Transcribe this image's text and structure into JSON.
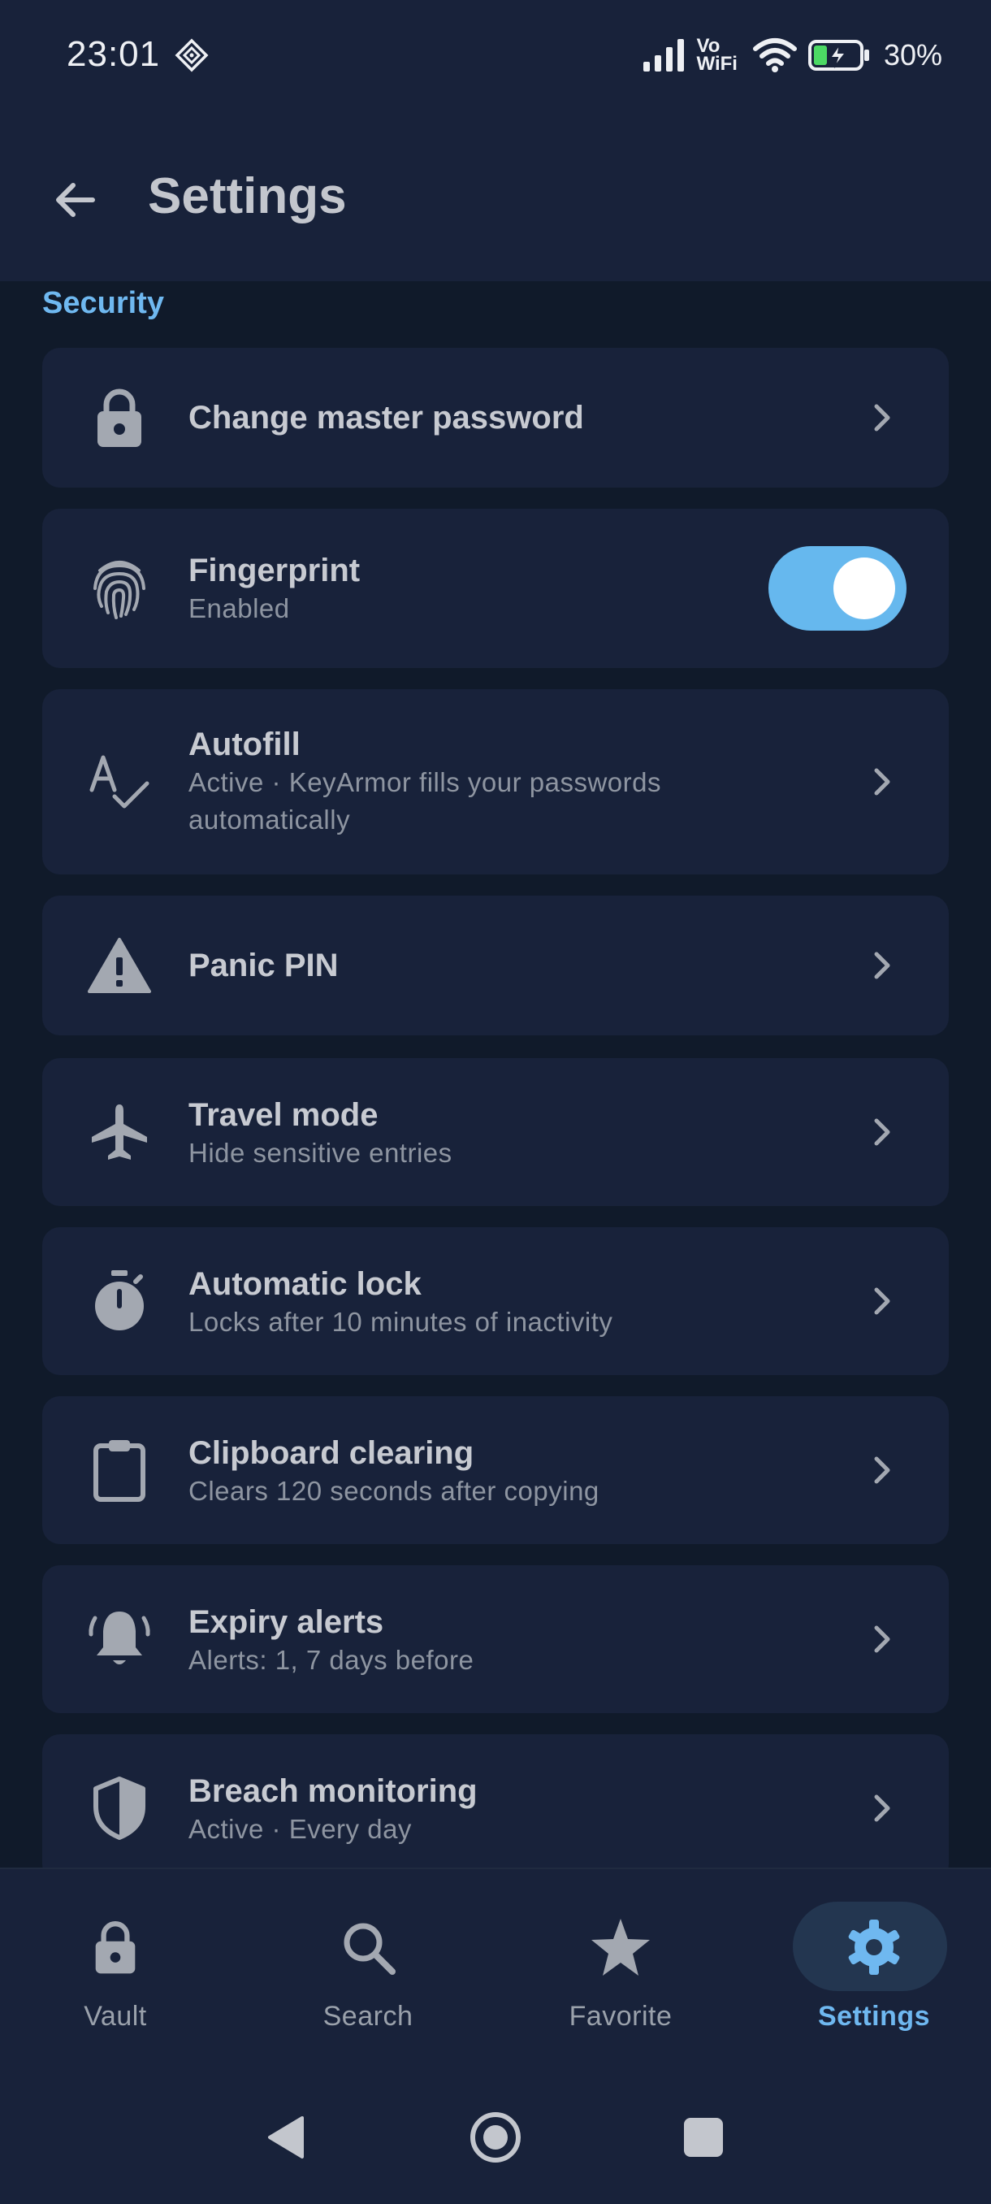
{
  "status": {
    "time": "23:01",
    "vo": "Vo",
    "wifi": "WiFi",
    "battery": "30%"
  },
  "appbar": {
    "title": "Settings"
  },
  "section": {
    "title": "Security"
  },
  "items": [
    {
      "title": "Change master password",
      "subtitle": "",
      "icon": "lock-icon",
      "trailing": "chevron"
    },
    {
      "title": "Fingerprint",
      "subtitle": "Enabled",
      "icon": "fingerprint-icon",
      "trailing": "toggle",
      "toggle_on": true
    },
    {
      "title": "Autofill",
      "subtitle": "Active · KeyArmor fills your passwords automatically",
      "icon": "spellcheck-icon",
      "trailing": "chevron"
    },
    {
      "title": "Panic PIN",
      "subtitle": "",
      "icon": "warning-icon",
      "trailing": "chevron"
    },
    {
      "title": "Travel mode",
      "subtitle": "Hide sensitive entries",
      "icon": "airplane-icon",
      "trailing": "chevron"
    },
    {
      "title": "Automatic lock",
      "subtitle": "Locks after 10 minutes of inactivity",
      "icon": "timer-icon",
      "trailing": "chevron"
    },
    {
      "title": "Clipboard clearing",
      "subtitle": "Clears 120 seconds after copying",
      "icon": "clipboard-icon",
      "trailing": "chevron"
    },
    {
      "title": "Expiry alerts",
      "subtitle": "Alerts: 1, 7 days before",
      "icon": "bell-icon",
      "trailing": "chevron"
    },
    {
      "title": "Breach monitoring",
      "subtitle": "Active · Every day",
      "icon": "shield-icon",
      "trailing": "chevron"
    }
  ],
  "nav": {
    "vault": "Vault",
    "search": "Search",
    "favorite": "Favorite",
    "settings": "Settings",
    "active": "settings"
  },
  "colors": {
    "background": "#101a2a",
    "surface": "#18223a",
    "accent": "#6fb8f0",
    "toggle": "#66b8ee"
  }
}
